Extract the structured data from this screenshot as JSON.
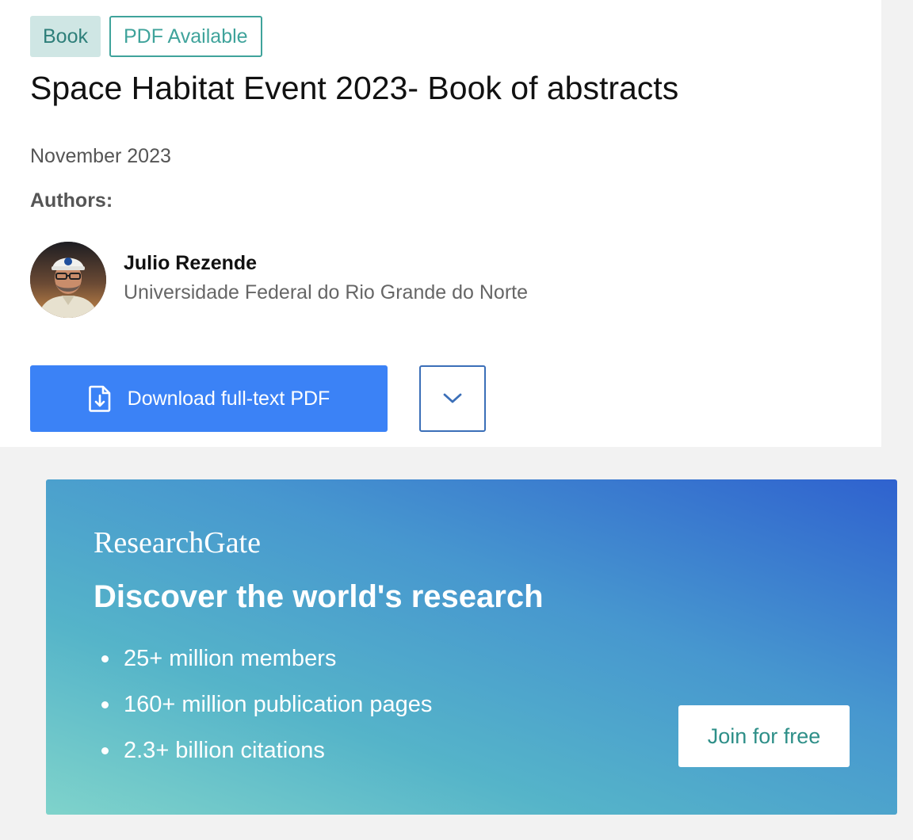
{
  "publication": {
    "type_badge": "Book",
    "pdf_badge": "PDF Available",
    "title": "Space Habitat Event 2023- Book of abstracts",
    "date": "November 2023",
    "authors_label": "Authors:",
    "authors": [
      {
        "name": "Julio Rezende",
        "affiliation": "Universidade Federal do Rio Grande do Norte",
        "avatar_icon": "author-photo"
      }
    ]
  },
  "actions": {
    "download_label": "Download full-text PDF",
    "download_icon": "file-download-icon",
    "more_icon": "chevron-down-icon"
  },
  "promo": {
    "brand": "ResearchGate",
    "headline": "Discover the world's research",
    "stats": [
      "25+ million members",
      "160+ million publication pages",
      "2.3+ billion citations"
    ],
    "join_label": "Join for free"
  },
  "colors": {
    "primary_button": "#3b82f6",
    "teal_accent": "#3fa39b",
    "badge_background": "#cfe6e4",
    "promo_gradient_start": "#7fd3cb",
    "promo_gradient_end": "#2f62cf",
    "page_background": "#f2f2f2"
  }
}
